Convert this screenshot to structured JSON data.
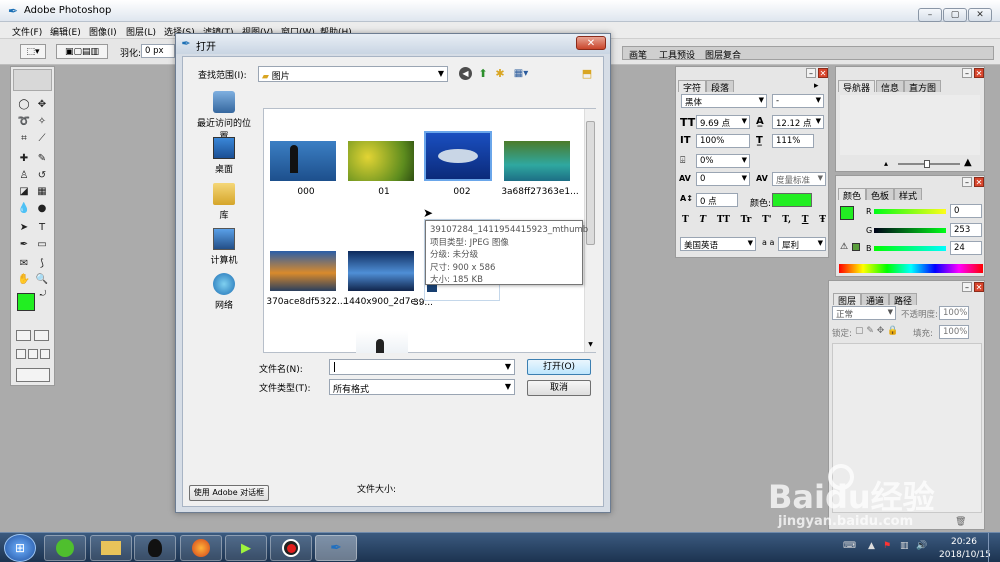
{
  "app": {
    "title": "Adobe Photoshop"
  },
  "menu": [
    "文件(F)",
    "编辑(E)",
    "图像(I)",
    "图层(L)",
    "选择(S)",
    "滤镜(T)",
    "视图(V)",
    "窗口(W)",
    "帮助(H)"
  ],
  "options": {
    "feather_label": "羽化:",
    "feather_value": "0 px"
  },
  "palette_well": [
    "画笔",
    "工具预设",
    "图层复合"
  ],
  "dialog": {
    "title": "打开",
    "lookin_label": "查找范围(I):",
    "lookin_value": "图片",
    "places": [
      "最近访问的位置",
      "桌面",
      "库",
      "计算机",
      "网络"
    ],
    "files": [
      {
        "name": "000"
      },
      {
        "name": "01"
      },
      {
        "name": "002"
      },
      {
        "name": "3a68ff27363e1..."
      },
      {
        "name": "370ace8df5322..."
      },
      {
        "name": "1440x900_2d7e..."
      },
      {
        "name": "39..."
      }
    ],
    "filename_label": "文件名(N):",
    "filename_value": "",
    "filetype_label": "文件类型(T):",
    "filetype_value": "所有格式",
    "open_button": "打开(O)",
    "cancel_button": "取消",
    "adobe_dialog_button": "使用 Adobe 对话框",
    "filesize_label": "文件大小:"
  },
  "tooltip": {
    "line1": "39107284_1411954415923_mthumb",
    "line2": "项目类型: JPEG 图像",
    "line3": "分级: 未分级",
    "line4": "尺寸: 900 x 586",
    "line5": "大小: 185 KB"
  },
  "char_panel": {
    "tabs": [
      "字符",
      "段落"
    ],
    "font": "黑体",
    "style": "-",
    "size": "9.69 点",
    "leading": "12.12 点",
    "vscale": "100%",
    "hscale": "111%",
    "tsume": "0%",
    "tracking": "0",
    "kerning": "度量标准",
    "baseline": "0 点",
    "color_label": "颜色:",
    "color": "#22ee22",
    "lang": "美国英语",
    "aa_label": "a a",
    "aa": "犀利",
    "styles": [
      "T",
      "T",
      "TT",
      "Tr",
      "T'",
      "T,",
      "T",
      "Ŧ"
    ]
  },
  "nav_panel": {
    "tabs": [
      "导航器",
      "信息",
      "直方图"
    ]
  },
  "color_panel": {
    "tabs": [
      "颜色",
      "色板",
      "样式"
    ],
    "r_label": "R",
    "r": "0",
    "g_label": "G",
    "g": "253",
    "b_label": "B",
    "b": "24"
  },
  "layers_panel": {
    "tabs": [
      "图层",
      "通道",
      "路径"
    ],
    "mode": "正常",
    "opacity_label": "不透明度:",
    "opacity": "100%",
    "lock_label": "锁定:",
    "fill_label": "填充:",
    "fill": "100%"
  },
  "taskbar": {
    "time": "20:26",
    "date": "2018/10/15"
  },
  "watermark": {
    "text": "Baidu经验",
    "url": "jingyan.baidu.com"
  }
}
